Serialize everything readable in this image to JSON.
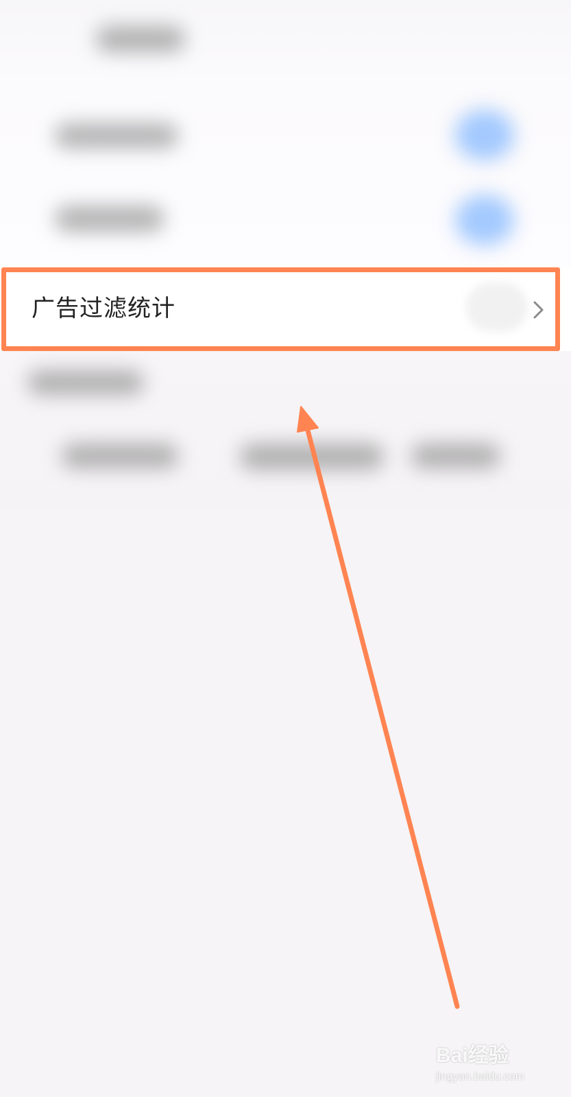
{
  "settings_row": {
    "label": "广告过滤统计",
    "chevron_icon": "chevron-right-icon"
  },
  "annotation": {
    "highlight_color": "#ff8452",
    "arrow_color": "#ff8452"
  },
  "watermark": {
    "main": "Bai经验",
    "sub": "jingyan.baidu.com"
  },
  "colors": {
    "background": "#f6f4f6",
    "row_background": "#ffffff",
    "text": "#222222",
    "chevron": "#8a8a8a"
  }
}
